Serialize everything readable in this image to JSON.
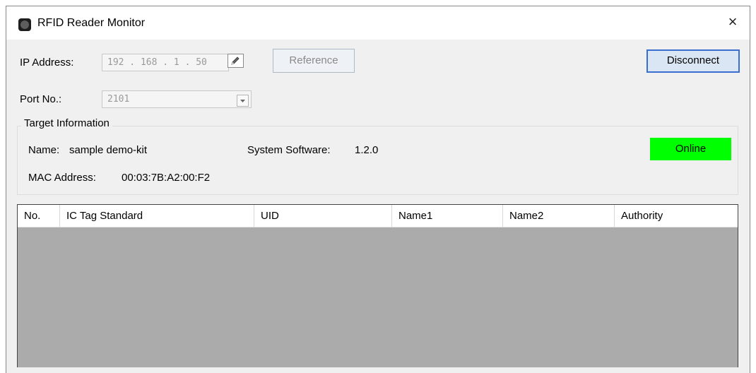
{
  "window": {
    "title": "RFID Reader Monitor",
    "close_glyph": "×"
  },
  "connection": {
    "ip_label": "IP Address:",
    "ip_value": "192 . 168 . 1 . 50",
    "edit_icon": "pencil-icon",
    "reference_label": "Reference",
    "disconnect_label": "Disconnect",
    "port_label": "Port No.:",
    "port_value": "2101",
    "port_dropdown_icon": "chevron-down-icon"
  },
  "target": {
    "group_title": "Target Information",
    "name_label": "Name:",
    "name_value": "sample demo-kit",
    "software_label": "System Software:",
    "software_value": "1.2.0",
    "mac_label": "MAC Address:",
    "mac_value": "00:03:7B:A2:00:F2",
    "status": "Online",
    "status_color": "#00ff00"
  },
  "table": {
    "columns": [
      "No.",
      "IC Tag Standard",
      "UID",
      "Name1",
      "Name2",
      "Authority"
    ],
    "rows": []
  }
}
